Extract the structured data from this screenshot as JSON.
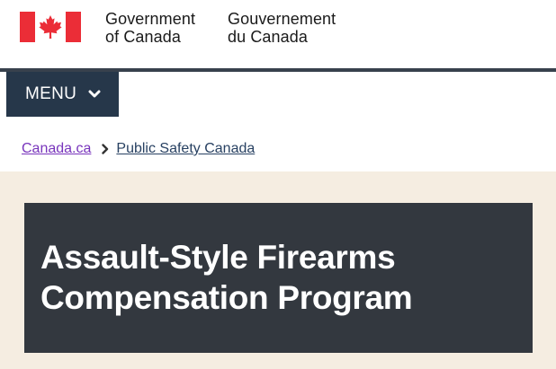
{
  "header": {
    "flag_icon": "canada-flag-icon",
    "wordmark_en_line1": "Government",
    "wordmark_en_line2": "of Canada",
    "wordmark_fr_line1": "Gouvernement",
    "wordmark_fr_line2": "du Canada"
  },
  "menu": {
    "label": "MENU",
    "icon": "chevron-down-icon"
  },
  "breadcrumb": {
    "items": [
      {
        "label": "Canada.ca"
      },
      {
        "label": "Public Safety Canada"
      }
    ],
    "separator_icon": "chevron-right-icon"
  },
  "hero": {
    "title_line1": "Assault-Style Firearms",
    "title_line2": "Compensation Program"
  },
  "colors": {
    "flag_red": "#eb2d37",
    "menu_bg": "#26374a",
    "visited_link": "#7834bc",
    "link": "#284162",
    "hero_band": "#f5ede1",
    "hero_box": "#33383f"
  }
}
